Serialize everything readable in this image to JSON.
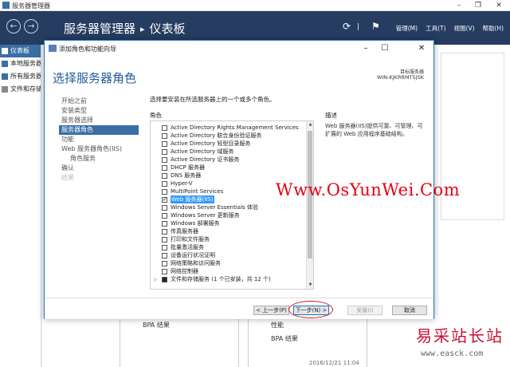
{
  "server_manager": {
    "window_title": "服务器管理器",
    "breadcrumb": [
      "服务器管理器",
      "仪表板"
    ],
    "menus": [
      "管理(M)",
      "工具(T)",
      "视图(V)",
      "帮助(H)"
    ],
    "sidebar": [
      "仪表板",
      "本地服务器",
      "所有服务器",
      "文件和存储服务"
    ],
    "cards": {
      "left_bpa": "BPA 结果",
      "right_perf": "性能",
      "right_bpa": "BPA 结果",
      "timestamp": "2016/12/21 11:04"
    }
  },
  "wizard": {
    "title": "添加角色和功能向导",
    "heading": "选择服务器角色",
    "target_label": "目标服务器",
    "target_server": "WIN-KJKRRMT5JSK",
    "steps": [
      {
        "label": "开始之前",
        "state": "normal"
      },
      {
        "label": "安装类型",
        "state": "normal"
      },
      {
        "label": "服务器选择",
        "state": "normal"
      },
      {
        "label": "服务器角色",
        "state": "active"
      },
      {
        "label": "功能",
        "state": "normal"
      },
      {
        "label": "Web 服务器角色(IIS)",
        "state": "normal"
      },
      {
        "label": "角色服务",
        "state": "sub"
      },
      {
        "label": "确认",
        "state": "normal"
      },
      {
        "label": "结果",
        "state": "disabled"
      }
    ],
    "instruction": "选择要安装在所选服务器上的一个或多个角色。",
    "roles_header": "角色",
    "roles": [
      {
        "label": "Active Directory Rights Management Services",
        "checked": false
      },
      {
        "label": "Active Directory 联合身份验证服务",
        "checked": false
      },
      {
        "label": "Active Directory 轻型目录服务",
        "checked": false
      },
      {
        "label": "Active Directory 域服务",
        "checked": false
      },
      {
        "label": "Active Directory 证书服务",
        "checked": false
      },
      {
        "label": "DHCP 服务器",
        "checked": false
      },
      {
        "label": "DNS 服务器",
        "checked": false
      },
      {
        "label": "Hyper-V",
        "checked": false
      },
      {
        "label": "MultiPoint Services",
        "checked": false
      },
      {
        "label": "Web 服务器(IIS)",
        "checked": true,
        "selected": true
      },
      {
        "label": "Windows Server Essentials 体验",
        "checked": false
      },
      {
        "label": "Windows Server 更新服务",
        "checked": false
      },
      {
        "label": "Windows 部署服务",
        "checked": false
      },
      {
        "label": "传真服务器",
        "checked": false
      },
      {
        "label": "打印和文件服务",
        "checked": false
      },
      {
        "label": "批量激活服务",
        "checked": false
      },
      {
        "label": "设备运行状况证明",
        "checked": false
      },
      {
        "label": "网络策略和访问服务",
        "checked": false
      },
      {
        "label": "网络控制器",
        "checked": false
      },
      {
        "label": "文件和存储服务 (1 个已安装，共 12 个)",
        "checked": "partial",
        "expandable": true
      }
    ],
    "description_header": "描述",
    "description": "Web 服务器(IIS)提供可靠、可管理、可扩展的 Web 应用程序基础结构。",
    "buttons": {
      "prev": "< 上一步(P)",
      "next": "下一步(N) >",
      "install": "安装(I)",
      "cancel": "取消"
    }
  },
  "watermarks": {
    "url": "Www.OsYunWei.Com",
    "logo": "易采站长站",
    "logo_url": "www.easck.com"
  }
}
